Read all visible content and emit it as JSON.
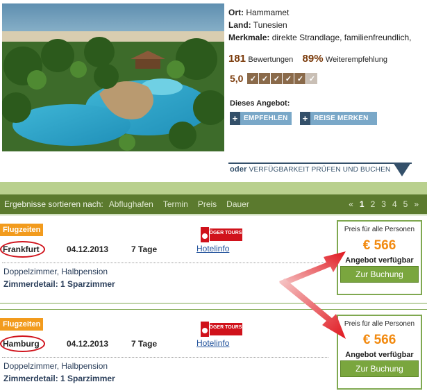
{
  "hotel": {
    "ort_label": "Ort:",
    "ort": "Hammamet",
    "land_label": "Land:",
    "land": "Tunesien",
    "merkmale_label": "Merkmale:",
    "merkmale": "direkte Strandlage, familienfreundlich,",
    "bewertungen_count": "181",
    "bewertungen_label": "Bewertungen",
    "empfehlung_pct": "89%",
    "empfehlung_label": "Weiterempfehlung",
    "score": "5,0",
    "rating_checks": 6,
    "rating_filled": 5
  },
  "offer": {
    "label": "Dieses Angebot:",
    "empfehlen": "EMPFEHLEN",
    "merken": "REISE MERKEN",
    "oder": "oder",
    "pruefen": "VERFÜGBARKEIT PRÜFEN UND BUCHEN"
  },
  "sort": {
    "lead": "Ergebnisse sortieren nach:",
    "options": [
      "Abflughafen",
      "Termin",
      "Preis",
      "Dauer"
    ],
    "pager_prev": "«",
    "pages": [
      "1",
      "2",
      "3",
      "4",
      "5"
    ],
    "current_page": "1",
    "pager_next": "»"
  },
  "results": [
    {
      "tag": "Flugzeiten",
      "city": "Frankfurt",
      "date": "04.12.2013",
      "days": "7 Tage",
      "operator": "ÖGER TOURS",
      "hotelinfo": "Hotelinfo",
      "room": "Doppelzimmer, Halbpension",
      "zimmer": "Zimmerdetail: 1 Sparzimmer",
      "price_label": "Preis für alle Personen",
      "price": "€ 566",
      "availability": "Angebot verfügbar",
      "book": "Zur Buchung"
    },
    {
      "tag": "Flugzeiten",
      "city": "Hamburg",
      "date": "04.12.2013",
      "days": "7 Tage",
      "operator": "ÖGER TOURS",
      "hotelinfo": "Hotelinfo",
      "room": "Doppelzimmer, Halbpension",
      "zimmer": "Zimmerdetail: 1 Sparzimmer",
      "price_label": "Preis für alle Personen",
      "price": "€ 566",
      "availability": "Angebot verfügbar",
      "book": "Zur Buchung"
    }
  ],
  "colors": {
    "accent_green": "#5b7a2e",
    "price_orange": "#f28a10",
    "highlight_red": "#d0121b",
    "action_blue": "#7aa8c8"
  }
}
